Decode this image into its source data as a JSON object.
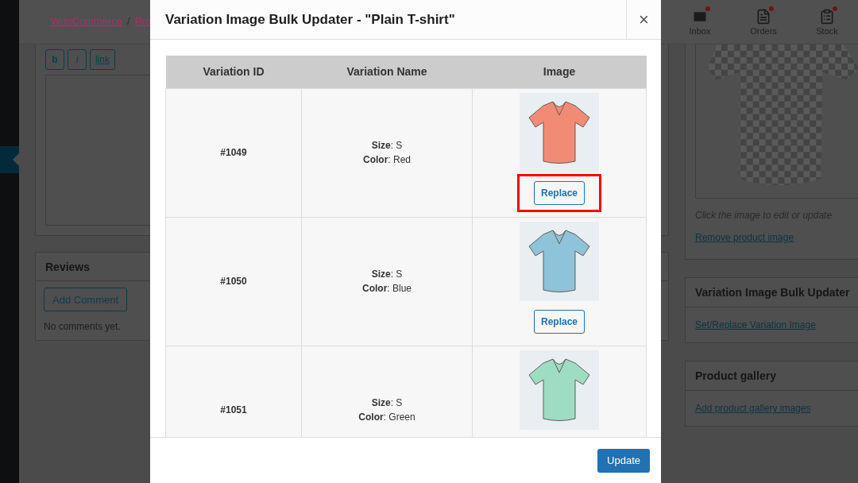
{
  "top_bar": {
    "breadcrumb": [
      {
        "label": "WooCommerce"
      },
      {
        "label": "Pro"
      }
    ],
    "separator": "/",
    "activity": [
      {
        "kind": "inbox",
        "label": "Inbox",
        "unread": true
      },
      {
        "kind": "orders",
        "label": "Orders",
        "unread": true
      },
      {
        "kind": "stock",
        "label": "Stock",
        "unread": true
      }
    ]
  },
  "editor": {
    "buttons": [
      {
        "label": "b",
        "kind": "bold"
      },
      {
        "label": "i",
        "kind": "italic"
      },
      {
        "label": "link",
        "kind": "link"
      }
    ]
  },
  "reviews": {
    "title": "Reviews",
    "button": "Add Comment",
    "empty": "No comments yet."
  },
  "product_image": {
    "hint": "Click the image to edit or update",
    "link": "Remove product image"
  },
  "bulk_updater_box": {
    "title": "Variation Image Bulk Updater",
    "link": "Set/Replace Variation Image"
  },
  "gallery_box": {
    "title": "Product gallery",
    "link": "Add product gallery images"
  },
  "modal": {
    "title": "Variation Image Bulk Updater - \"Plain T-shirt\"",
    "close": "×",
    "table": {
      "columns": [
        "Variation ID",
        "Variation Name",
        "Image"
      ],
      "rows": [
        {
          "id": "#1049",
          "attributes": [
            "**Size**: S",
            "**Color**: Red"
          ],
          "color": "#f28b76",
          "button": "Replace",
          "highlighted": true
        },
        {
          "id": "#1050",
          "attributes": [
            "**Size**: S",
            "**Color**: Blue"
          ],
          "color": "#8ec3d9",
          "button": "Replace",
          "highlighted": false
        },
        {
          "id": "#1051",
          "attributes": [
            "**Size**: S",
            "**Color**: Green"
          ],
          "color": "#9edcc3"
        }
      ]
    },
    "footer_button": "Update"
  }
}
